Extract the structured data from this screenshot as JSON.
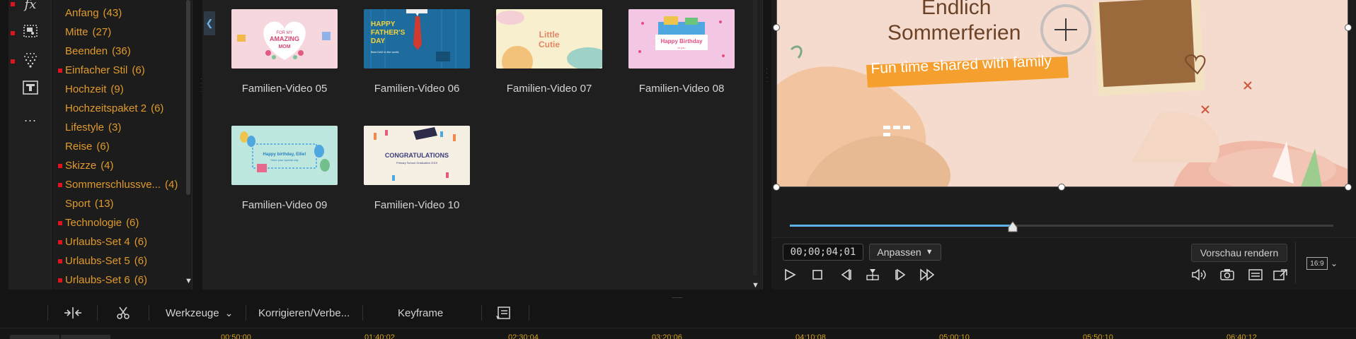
{
  "left_rail": {
    "icons": [
      "fx-icon",
      "overlay-icon",
      "particle-icon",
      "title-icon",
      "more-icon"
    ],
    "fx_label": "fx",
    "more_label": "..."
  },
  "categories": [
    {
      "label": "Anfang",
      "count": "(43)",
      "dot": false
    },
    {
      "label": "Mitte",
      "count": "(27)",
      "dot": false
    },
    {
      "label": "Beenden",
      "count": "(36)",
      "dot": false
    },
    {
      "label": "Einfacher Stil",
      "count": "(6)",
      "dot": true
    },
    {
      "label": "Hochzeit",
      "count": "(9)",
      "dot": false
    },
    {
      "label": "Hochzeitspaket 2",
      "count": "(6)",
      "dot": false
    },
    {
      "label": "Lifestyle",
      "count": "(3)",
      "dot": false
    },
    {
      "label": "Reise",
      "count": "(6)",
      "dot": false
    },
    {
      "label": "Skizze",
      "count": "(4)",
      "dot": true
    },
    {
      "label": "Sommerschlussve...",
      "count": "(4)",
      "dot": true
    },
    {
      "label": "Sport",
      "count": "(13)",
      "dot": false
    },
    {
      "label": "Technologie",
      "count": "(6)",
      "dot": true
    },
    {
      "label": "Urlaubs-Set 4",
      "count": "(6)",
      "dot": true
    },
    {
      "label": "Urlaubs-Set 5",
      "count": "(6)",
      "dot": true
    },
    {
      "label": "Urlaubs-Set 6",
      "count": "(6)",
      "dot": true
    }
  ],
  "templates": [
    {
      "label": "Familien-Video 05",
      "thumb_text": [
        "FOR MY",
        "AMAZING",
        "MOM"
      ]
    },
    {
      "label": "Familien-Video 06",
      "thumb_text": [
        "HAPPY",
        "FATHER'S",
        "DAY",
        "Best DAD in the world."
      ]
    },
    {
      "label": "Familien-Video 07",
      "thumb_text": [
        "Little",
        "Cutie"
      ]
    },
    {
      "label": "Familien-Video 08",
      "thumb_text": [
        "Happy Birthday",
        "to you"
      ]
    },
    {
      "label": "Familien-Video 09",
      "thumb_text": [
        "Happy birthday, Ellie!",
        "Have your special day"
      ]
    },
    {
      "label": "Familien-Video 10",
      "thumb_text": [
        "CONGRATULATIONS",
        "Primary School Graduation 2019"
      ]
    }
  ],
  "preview": {
    "title_line1": "Endlich",
    "title_line2": "Sommerferien",
    "banner": "Fun time shared with family"
  },
  "playback": {
    "progress": 0.41,
    "timecode": "00;00;04;01",
    "fit_label": "Anpassen",
    "render_label": "Vorschau rendern",
    "aspect_ratio": "16:9"
  },
  "toolbar": {
    "tools_label": "Werkzeuge",
    "fix_label": "Korrigieren/Verbe...",
    "keyframe_label": "Keyframe"
  },
  "ruler": {
    "ticks": [
      "00;50;00",
      "01;40;02",
      "02;30;04",
      "03;20;06",
      "04;10;08",
      "05;00;10",
      "05;50;10",
      "06;40;12"
    ]
  },
  "colors": {
    "category_text": "#e09a2b",
    "status_dot": "#e0141e",
    "accent_blue": "#5db3e8",
    "ruler_text": "#d4a21a"
  }
}
